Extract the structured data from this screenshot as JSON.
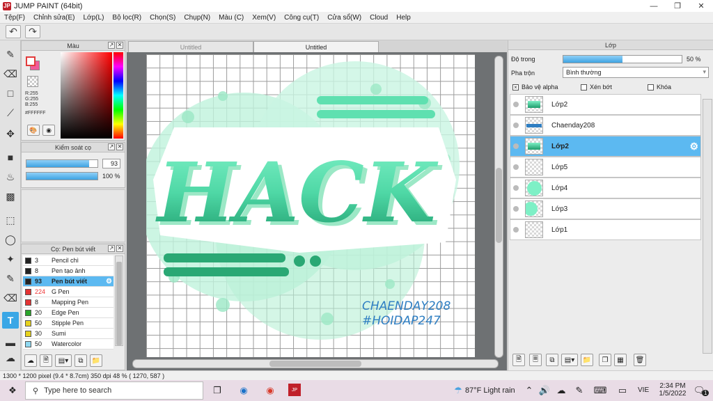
{
  "window": {
    "title": "JUMP PAINT (64bit)",
    "app_icon": "JP"
  },
  "menu": [
    "Tệp(F)",
    "Chỉnh sửa(E)",
    "Lớp(L)",
    "Bộ lọc(R)",
    "Chọn(S)",
    "Chụp(N)",
    "Màu (C)",
    "Xem(V)",
    "Công cụ(T)",
    "Cửa sổ(W)",
    "Cloud",
    "Help"
  ],
  "color_panel": {
    "title": "Màu",
    "r": "R:255",
    "g": "G:255",
    "b": "B:255",
    "hex": "#FFFFFF",
    "fg_color": "#ffffff",
    "bg_color": "#f05a9a"
  },
  "brush_control": {
    "title": "Kiểm soát cọ",
    "size_value": "93",
    "opacity_label": "100 %"
  },
  "brush_list": {
    "title": "Cọ: Pen bút viết",
    "items": [
      {
        "num": "3",
        "name": "Pencil chì",
        "color": "#222222"
      },
      {
        "num": "8",
        "name": "Pen tạo ảnh",
        "color": "#222222"
      },
      {
        "num": "93",
        "name": "Pen bút viết",
        "color": "#222222",
        "selected": true
      },
      {
        "num": "224",
        "name": "G Pen",
        "color": "#e33333"
      },
      {
        "num": "8",
        "name": "Mapping Pen",
        "color": "#e33333"
      },
      {
        "num": "20",
        "name": "Edge Pen",
        "color": "#2aa52a"
      },
      {
        "num": "50",
        "name": "Stipple Pen",
        "color": "#e6d21e"
      },
      {
        "num": "30",
        "name": "Sumi",
        "color": "#e6d21e"
      },
      {
        "num": "50",
        "name": "Watercolor",
        "color": "#8fd8f0"
      }
    ]
  },
  "tabs": [
    "Untitled",
    "Untitled"
  ],
  "artwork": {
    "main_text": "HACK",
    "credit_1": "CHAENDAY208",
    "credit_2": "#HOIDAP247",
    "accent": "#4fd8a6",
    "dark": "#1e9c6c"
  },
  "layer_panel": {
    "title": "Lớp",
    "opacity_label": "Độ trong",
    "opacity_value": "50 %",
    "opacity_fraction": 0.5,
    "blend_label": "Pha trộn",
    "blend_value": "Bình thường",
    "protect_alpha": "Bảo vệ alpha",
    "clipping": "Xén bớt",
    "lock": "Khóa",
    "layers": [
      {
        "name": "Lớp2",
        "thumb": "text"
      },
      {
        "name": "Chaenday208",
        "thumb": "banner"
      },
      {
        "name": "Lớp2",
        "thumb": "text",
        "selected": true
      },
      {
        "name": "Lớp5",
        "thumb": "empty"
      },
      {
        "name": "Lớp4",
        "thumb": "circle"
      },
      {
        "name": "Lớp3",
        "thumb": "circle-left"
      },
      {
        "name": "Lớp1",
        "thumb": "empty"
      }
    ]
  },
  "status": {
    "text": "1300 * 1200 pixel   (9.4 * 8.7cm)   350 dpi   48 %   ( 1270, 587 )"
  },
  "taskbar": {
    "search_placeholder": "Type here to search",
    "weather": "87°F  Light rain",
    "lang": "VIE",
    "time": "2:34 PM",
    "date": "1/5/2022",
    "notif": "1"
  }
}
